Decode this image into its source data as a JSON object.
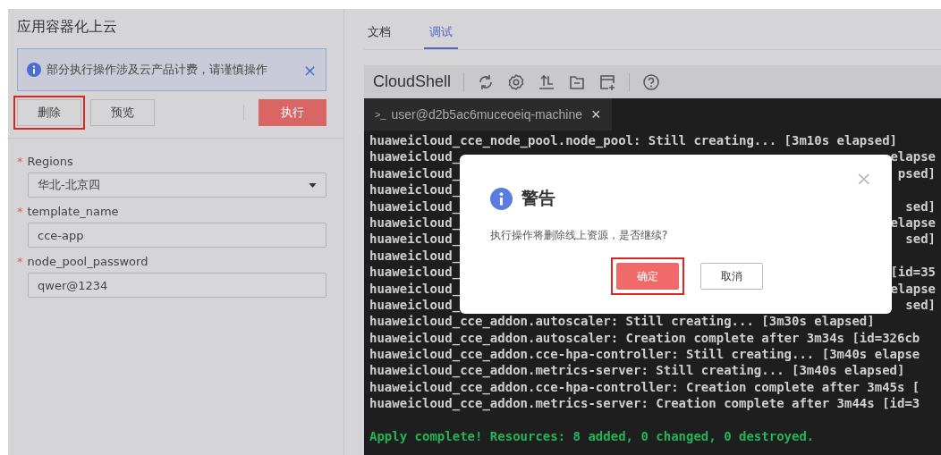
{
  "left_panel": {
    "title": "应用容器化上云",
    "notice": {
      "text": "部分执行操作涉及云产品计费，请谨慎操作",
      "close": "×"
    },
    "buttons": [
      {
        "label": "删除",
        "kind": "default",
        "highlighted": true
      },
      {
        "label": "预览",
        "kind": "default",
        "highlighted": false
      },
      {
        "label": "执行",
        "kind": "primary",
        "highlighted": false
      }
    ],
    "fields": [
      {
        "label": "Regions",
        "required_mark": "*",
        "kind": "select",
        "value": "华北-北京四"
      },
      {
        "label": "template_name",
        "required_mark": "*",
        "kind": "input",
        "value": "cce-app"
      },
      {
        "label": "node_pool_password",
        "required_mark": "*",
        "kind": "input",
        "value": "qwer@1234"
      }
    ]
  },
  "tabs": [
    {
      "label": "文档",
      "selected": false
    },
    {
      "label": "调试",
      "selected": true
    }
  ],
  "cloudshell": {
    "title": "CloudShell",
    "session_tab": {
      "prompt": ">_",
      "label": "user@d2b5ac6muceoeiq-machine",
      "close": "×"
    },
    "lines": [
      {
        "kind": "text",
        "text": "huaweicloud_cce_node_pool.node_pool: Still creating... [3m10s elapsed]"
      },
      {
        "kind": "covered",
        "left": "huaweicloud_",
        "right": "elapse"
      },
      {
        "kind": "covered",
        "left": "huaweicloud_",
        "right": "psed]"
      },
      {
        "kind": "covered",
        "left": "huaweicloud_"
      },
      {
        "kind": "covered",
        "left": "huaweicloud_",
        "right": "sed]"
      },
      {
        "kind": "covered",
        "left": "huaweicloud_",
        "right": "elapse"
      },
      {
        "kind": "covered",
        "left": "huaweicloud_",
        "right": "sed]"
      },
      {
        "kind": "covered",
        "left": "huaweicloud_"
      },
      {
        "kind": "covered",
        "left": "huaweicloud_",
        "right": "[id=35"
      },
      {
        "kind": "covered",
        "left": "huaweicloud_",
        "right": "elapse"
      },
      {
        "kind": "covered",
        "left": "huaweicloud_",
        "right": "sed]"
      },
      {
        "kind": "text",
        "text": "huaweicloud_cce_addon.autoscaler: Still creating... [3m30s elapsed]"
      },
      {
        "kind": "text",
        "text": "huaweicloud_cce_addon.autoscaler: Creation complete after 3m34s [id=326cb"
      },
      {
        "kind": "text",
        "text": "huaweicloud_cce_addon.cce-hpa-controller: Still creating... [3m40s elapse"
      },
      {
        "kind": "text",
        "text": "huaweicloud_cce_addon.metrics-server: Still creating... [3m40s elapsed]"
      },
      {
        "kind": "text",
        "text": "huaweicloud_cce_addon.cce-hpa-controller: Creation complete after 3m45s ["
      },
      {
        "kind": "text",
        "text": "huaweicloud_cce_addon.metrics-server: Creation complete after 3m44s [id=3"
      },
      {
        "kind": "blank"
      },
      {
        "kind": "success",
        "text": "Apply complete! Resources: 8 added, 0 changed, 0 destroyed."
      }
    ]
  },
  "dialog": {
    "title": "警告",
    "message": "执行操作将删除线上资源，是否继续?",
    "close": "×",
    "buttons": [
      {
        "label": "确定",
        "kind": "primary",
        "highlighted": true
      },
      {
        "label": "取消",
        "kind": "default",
        "highlighted": false
      }
    ]
  }
}
